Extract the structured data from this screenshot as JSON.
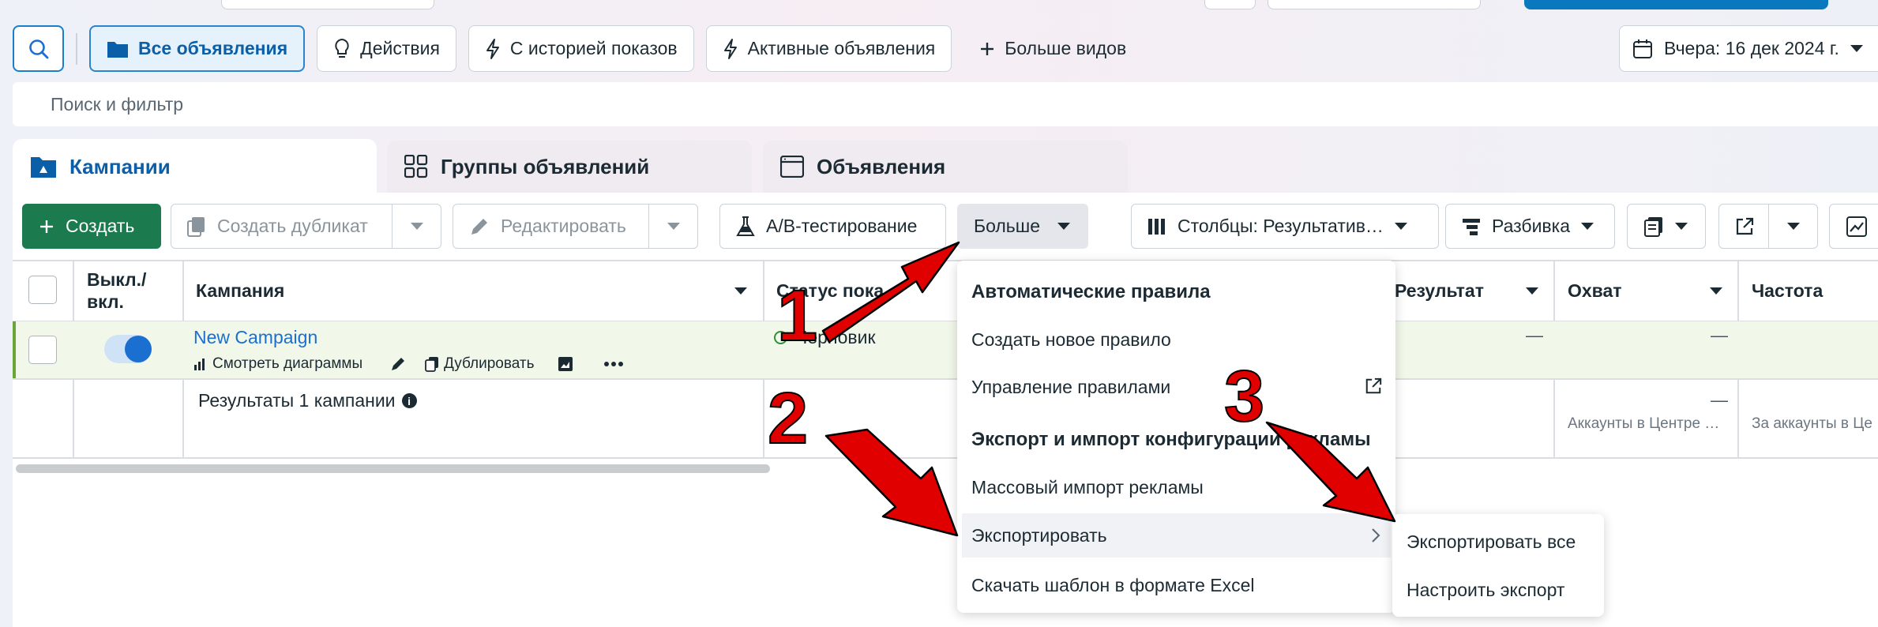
{
  "view_bar": {
    "buttons": [
      {
        "label": "Все объявления",
        "icon": "folder-icon"
      },
      {
        "label": "Действия",
        "icon": "lightbulb-icon"
      },
      {
        "label": "С историей показов",
        "icon": "bolt-icon"
      },
      {
        "label": "Активные объявления",
        "icon": "bolt-icon"
      },
      {
        "label": "Больше видов",
        "icon": "plus-icon"
      }
    ],
    "date_label": "Вчера: 16 дек 2024 г."
  },
  "search": {
    "placeholder": "Поиск и фильтр"
  },
  "tabs": [
    {
      "label": "Кампании",
      "icon": "folder-icon"
    },
    {
      "label": "Группы объявлений",
      "icon": "grid-icon"
    },
    {
      "label": "Объявления",
      "icon": "window-icon"
    }
  ],
  "toolbar": {
    "create": "Создать",
    "duplicate": "Создать дубликат",
    "edit": "Редактировать",
    "ab_test": "A/B-тестирование",
    "more": "Больше",
    "columns": "Столбцы: Результатив…",
    "breakdown": "Разбивка"
  },
  "table": {
    "headers": {
      "toggle": "Выкл./вкл.",
      "campaign": "Кампания",
      "status": "Статус пока",
      "result": "Результат",
      "reach": "Охват",
      "frequency": "Частота"
    },
    "row": {
      "name": "New Campaign",
      "view_charts": "Смотреть диаграммы",
      "duplicate": "Дублировать",
      "status": "Черновик",
      "result": "—",
      "reach": "—"
    },
    "summary": {
      "label": "Результаты 1 кампании",
      "reach": "—",
      "reach_note": "Аккаунты в Центре …",
      "frequency_note": "За аккаунты в Це"
    }
  },
  "menu": {
    "section1": "Автоматические правила",
    "create_rule": "Создать новое правило",
    "manage_rules": "Управление правилами",
    "section2": "Экспорт и импорт конфигурации рекламы",
    "bulk_import": "Массовый импорт рекламы",
    "export": "Экспортировать",
    "excel_template": "Скачать шаблон в формате Excel"
  },
  "submenu": {
    "export_all": "Экспортировать все",
    "configure_export": "Настроить экспорт"
  },
  "annotations": [
    "1",
    "2",
    "3"
  ],
  "colors": {
    "accent": "#1a6fd1",
    "create": "#1c7a4f",
    "arrow": "#e00000"
  }
}
